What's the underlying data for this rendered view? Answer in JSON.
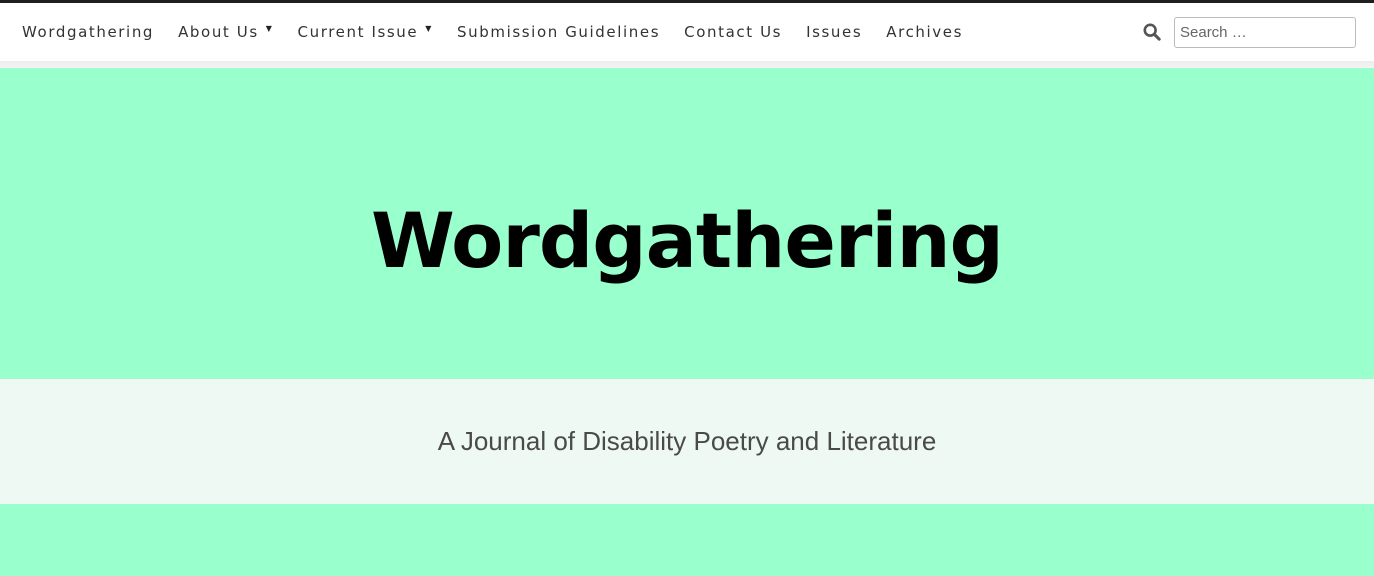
{
  "nav": {
    "items": [
      {
        "label": "Wordgathering",
        "dropdown": false
      },
      {
        "label": "About Us",
        "dropdown": true
      },
      {
        "label": "Current Issue",
        "dropdown": true
      },
      {
        "label": "Submission Guidelines",
        "dropdown": false
      },
      {
        "label": "Contact Us",
        "dropdown": false
      },
      {
        "label": "Issues",
        "dropdown": false
      },
      {
        "label": "Archives",
        "dropdown": false
      }
    ],
    "caret_glyph": "▼"
  },
  "search": {
    "placeholder": "Search …",
    "value": "",
    "icon": "search-icon"
  },
  "hero": {
    "title": "Wordgathering",
    "tagline": "A Journal of Disability Poetry and Literature"
  },
  "colors": {
    "hero_background": "#99ffcc",
    "tagline_background": "#eff9f4",
    "top_border": "#1f1f1f",
    "nav_text": "#333333",
    "title_text": "#000000",
    "tagline_text": "#4a4a4a"
  }
}
